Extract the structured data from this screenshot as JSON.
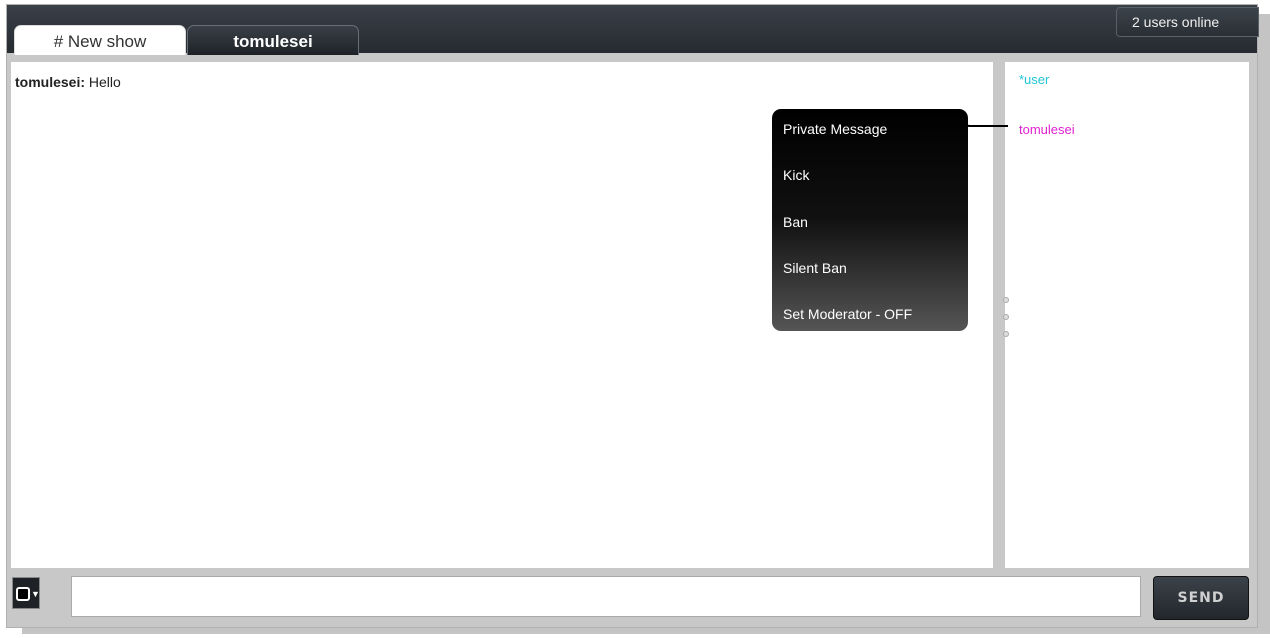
{
  "tabs": [
    {
      "label": "# New show"
    },
    {
      "label": "tomulesei"
    }
  ],
  "status": {
    "users_online": "2 users online"
  },
  "chat": {
    "messages": [
      {
        "user": "tomulesei:",
        "text": "Hello"
      }
    ]
  },
  "context_menu": {
    "items": [
      "Private Message",
      "Kick",
      "Ban",
      "Silent Ban",
      "Set Moderator - OFF"
    ]
  },
  "user_list": [
    {
      "name": "*user",
      "color": "#22c4d8"
    },
    {
      "name": "tomulesei",
      "color": "#e020d0"
    }
  ],
  "composer": {
    "input_value": "",
    "send_label": "SEND",
    "color_picker_icon": "color-swatch-icon"
  }
}
